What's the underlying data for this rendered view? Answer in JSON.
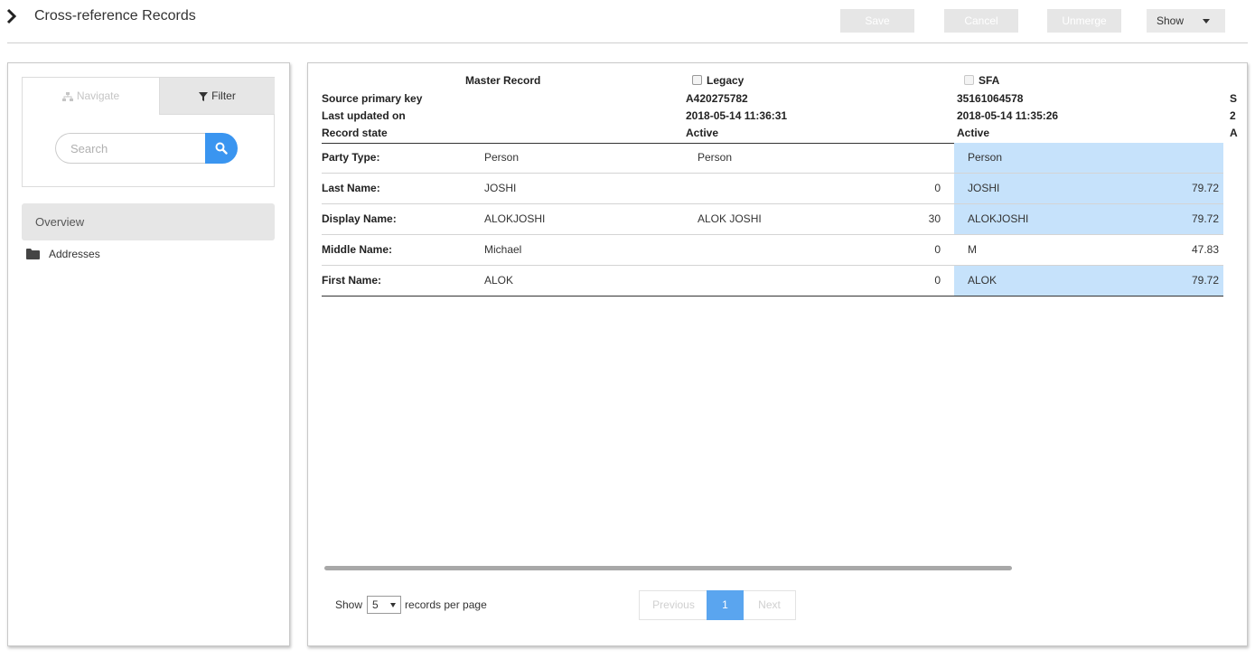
{
  "header": {
    "title": "Cross-reference Records",
    "save_label": "Save",
    "cancel_label": "Cancel",
    "unmerge_label": "Unmerge",
    "show_label": "Show"
  },
  "sidebar": {
    "tab_navigate": "Navigate",
    "tab_filter": "Filter",
    "search_placeholder": "Search",
    "overview_label": "Overview",
    "addresses_label": "Addresses"
  },
  "records": {
    "master_header": "Master Record",
    "legacy_header": "Legacy",
    "sfa_header": "SFA",
    "meta_labels": [
      "Source primary key",
      "Last updated on",
      "Record state"
    ],
    "legacy_meta": [
      "A420275782",
      "2018-05-14 11:36:31",
      "Active"
    ],
    "sfa_meta": [
      "35161064578",
      "2018-05-14 11:35:26",
      "Active"
    ],
    "extra_meta": [
      "S",
      "2",
      "A"
    ],
    "rows": [
      {
        "label": "Party Type:",
        "master": "Person",
        "legacy": "Person",
        "legacy_score": "",
        "sfa": "Person",
        "sfa_score": "",
        "highlight": true
      },
      {
        "label": "Last Name:",
        "master": "JOSHI",
        "legacy": "",
        "legacy_score": "0",
        "sfa": "JOSHI",
        "sfa_score": "79.72",
        "highlight": true
      },
      {
        "label": "Display Name:",
        "master": "ALOKJOSHI",
        "legacy": "ALOK JOSHI",
        "legacy_score": "30",
        "sfa": "ALOKJOSHI",
        "sfa_score": "79.72",
        "highlight": true
      },
      {
        "label": "Middle Name:",
        "master": "Michael",
        "legacy": "",
        "legacy_score": "0",
        "sfa": "M",
        "sfa_score": "47.83",
        "highlight": false
      },
      {
        "label": "First Name:",
        "master": "ALOK",
        "legacy": "",
        "legacy_score": "0",
        "sfa": "ALOK",
        "sfa_score": "79.72",
        "highlight": true
      }
    ]
  },
  "pagination": {
    "show_label": "Show",
    "per_page_value": "5",
    "per_page_suffix": "records per page",
    "previous_label": "Previous",
    "current_page": "1",
    "next_label": "Next"
  },
  "colors": {
    "accent": "#3a95f0",
    "highlight": "#c6e2fb",
    "current_page": "#5aa5ef"
  }
}
